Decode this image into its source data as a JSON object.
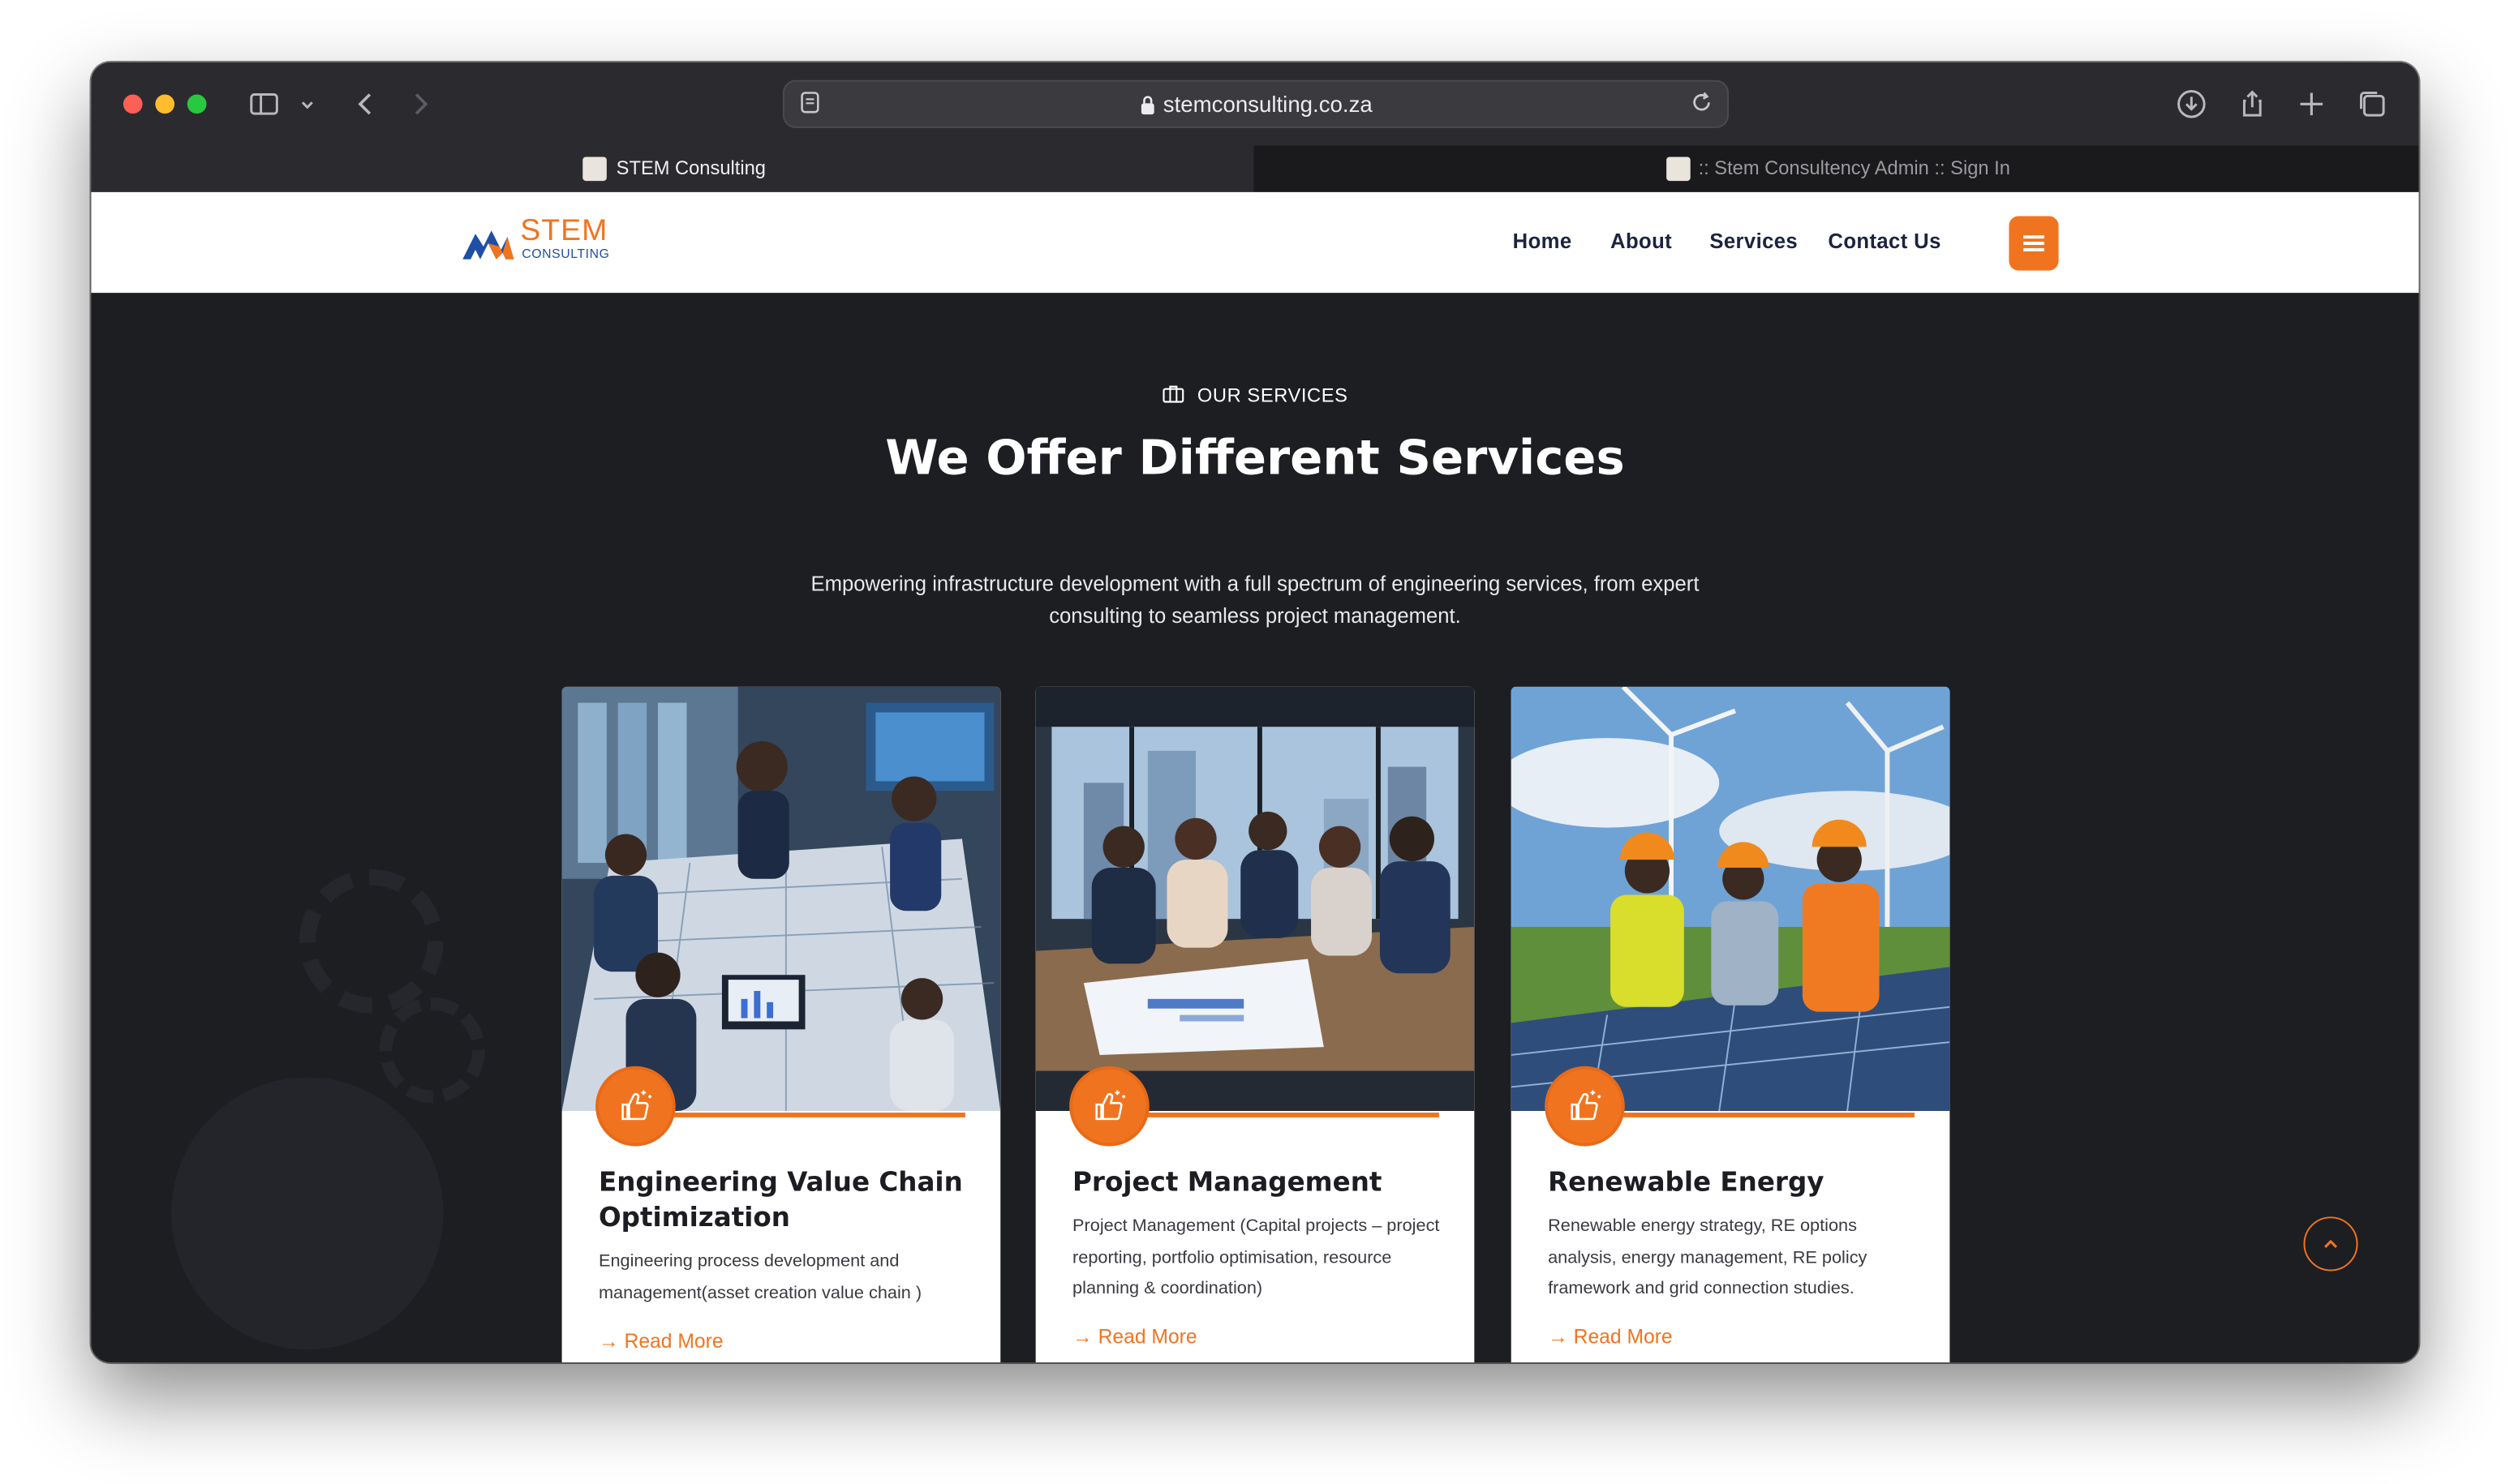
{
  "browser": {
    "url": "stemconsulting.co.za",
    "tabs": [
      {
        "title": "STEM Consulting",
        "active": true
      },
      {
        "title": ":: Stem Consultency Admin :: Sign In",
        "active": false
      }
    ]
  },
  "site": {
    "logo": {
      "word": "STEM",
      "tagline": "CONSULTING"
    },
    "nav": [
      {
        "label": "Home"
      },
      {
        "label": "About"
      },
      {
        "label": "Services"
      },
      {
        "label": "Contact Us"
      }
    ],
    "menu_icon": "hamburger-icon"
  },
  "services": {
    "eyebrow": "OUR SERVICES",
    "heading": "We Offer Different Services",
    "subheading": "Empowering infrastructure development with a full spectrum of engineering services, from expert consulting to seamless project management.",
    "cards": [
      {
        "title": "Engineering Value Chain Optimization",
        "description": "Engineering process development and management(asset creation value chain )",
        "link": "Read More",
        "icon": "thumbs-up-sparkle-icon"
      },
      {
        "title": "Project Management",
        "description": "Project Management (Capital projects – project reporting, portfolio optimisation, resource planning & coordination)",
        "link": "Read More",
        "icon": "thumbs-up-sparkle-icon"
      },
      {
        "title": "Renewable Energy",
        "description": "Renewable energy strategy, RE options analysis, energy management, RE policy framework and grid connection studies.",
        "link": "Read More",
        "icon": "thumbs-up-sparkle-icon"
      }
    ]
  },
  "colors": {
    "accent": "#f0741f",
    "dark_background": "#1d1e22",
    "nav_text": "#1c2340",
    "logo_blue": "#1f4fa3"
  }
}
